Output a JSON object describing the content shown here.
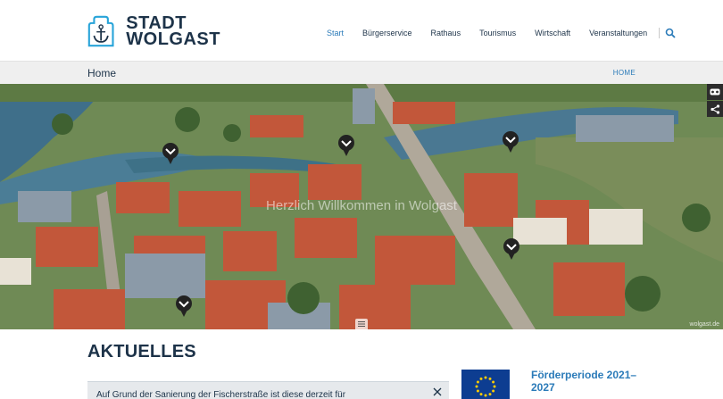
{
  "logo": {
    "line1": "STADT",
    "line2": "WOLGAST"
  },
  "nav": {
    "items": [
      {
        "label": "Start",
        "active": true
      },
      {
        "label": "Bürgerservice",
        "active": false
      },
      {
        "label": "Rathaus",
        "active": false
      },
      {
        "label": "Tourismus",
        "active": false
      },
      {
        "label": "Wirtschaft",
        "active": false
      },
      {
        "label": "Veranstaltungen",
        "active": false
      }
    ],
    "search_icon": "search-icon"
  },
  "breadcrumb": {
    "title": "Home",
    "link": "HOME"
  },
  "hero": {
    "caption": "Herzlich Willkommen in Wolgast",
    "credit": "wolgast.de",
    "tools": [
      "vr-icon",
      "share-icon"
    ]
  },
  "news": {
    "title": "AKTUELLES"
  },
  "notice": {
    "text": "Auf Grund der Sanierung der Fischerstraße ist diese derzeit für"
  },
  "funding": {
    "title": "Förderperiode 2021–2027"
  },
  "colors": {
    "brand_dark": "#1d3349",
    "accent": "#2b7bb9",
    "eu_blue": "#0d3d91",
    "eu_gold": "#ffcc00"
  }
}
